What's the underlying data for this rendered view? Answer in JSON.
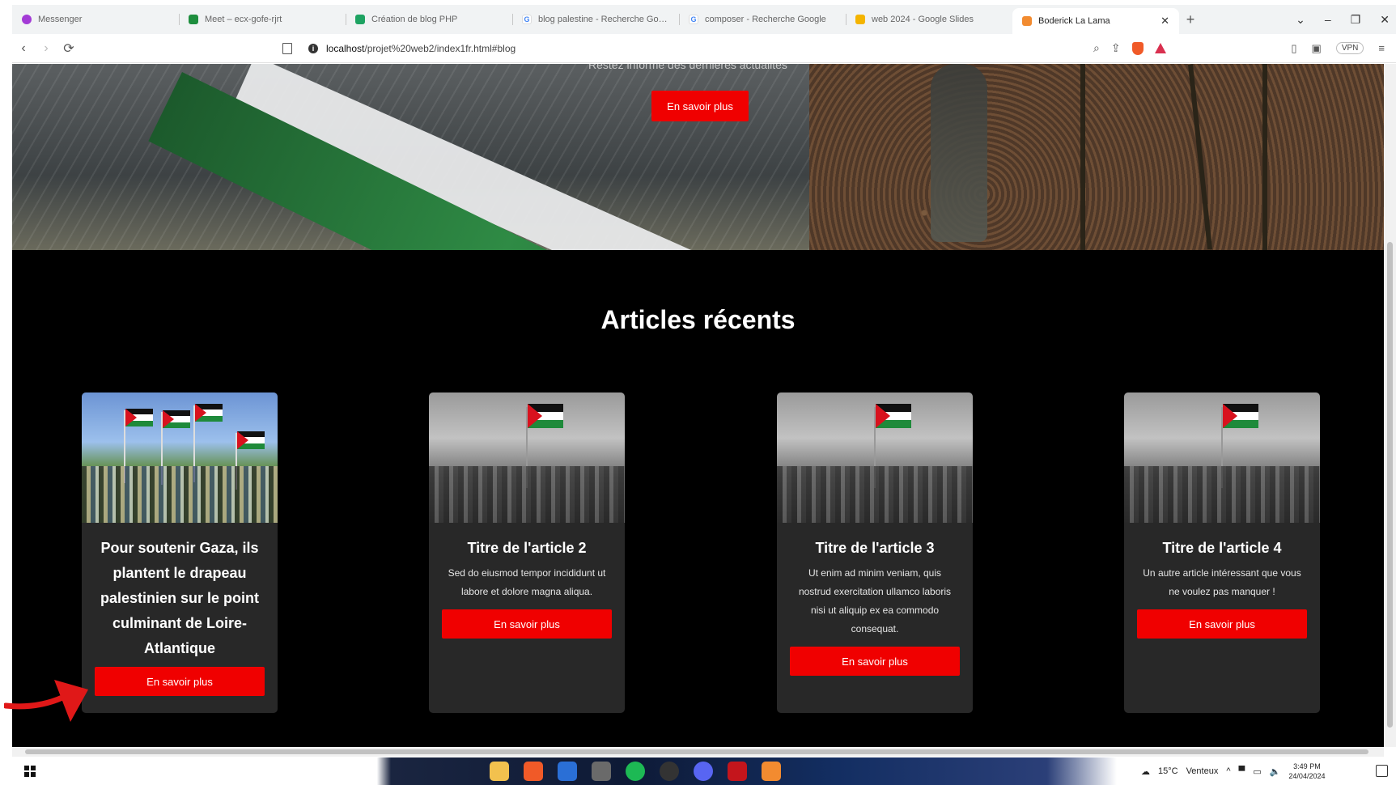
{
  "browser": {
    "tabs": [
      {
        "title": "Messenger",
        "color": "#a33bd6",
        "glyph": "●"
      },
      {
        "title": "Meet – ecx-gofe-rjrt",
        "color": "#1e8e3e",
        "glyph": "▶"
      },
      {
        "title": "Création de blog PHP",
        "color": "#1ea362",
        "glyph": "▦"
      },
      {
        "title": "blog palestine - Recherche Google",
        "color": "#4285f4",
        "glyph": "G"
      },
      {
        "title": "composer - Recherche Google",
        "color": "#4285f4",
        "glyph": "G"
      },
      {
        "title": "web 2024 - Google Slides",
        "color": "#f4b400",
        "glyph": "▭"
      },
      {
        "title": "Boderick La Lama",
        "color": "#f28b30",
        "glyph": "▤",
        "active": true
      }
    ],
    "url_host": "localhost",
    "url_path": "/projet%20web2/index1fr.html#blog",
    "vpn_label": "VPN"
  },
  "hero": {
    "subtitle": "Restez informé des dernières actualités",
    "button_label": "En savoir plus"
  },
  "section": {
    "title": "Articles récents"
  },
  "articles": [
    {
      "title": "Pour soutenir Gaza, ils plantent le drapeau palestinien sur le point culminant de Loire-Atlantique",
      "text": "",
      "button_label": "En savoir plus",
      "image": "color-photo"
    },
    {
      "title": "Titre de l'article 2",
      "text": "Sed do eiusmod tempor incididunt ut labore et dolore magna aliqua.",
      "button_label": "En savoir plus",
      "image": "bw-photo"
    },
    {
      "title": "Titre de l'article 3",
      "text": "Ut enim ad minim veniam, quis nostrud exercitation ullamco laboris nisi ut aliquip ex ea commodo consequat.",
      "button_label": "En savoir plus",
      "image": "bw-photo"
    },
    {
      "title": "Titre de l'article 4",
      "text": "Un autre article intéressant que vous ne voulez pas manquer !",
      "button_label": "En savoir plus",
      "image": "bw-photo"
    }
  ],
  "taskbar": {
    "weather": "15°C",
    "weather_desc": "Venteux",
    "time": "3:49 PM",
    "date": "24/04/2024"
  },
  "colors": {
    "accent_red": "#f00000",
    "card_bg": "#282828",
    "page_bg": "#000000"
  }
}
